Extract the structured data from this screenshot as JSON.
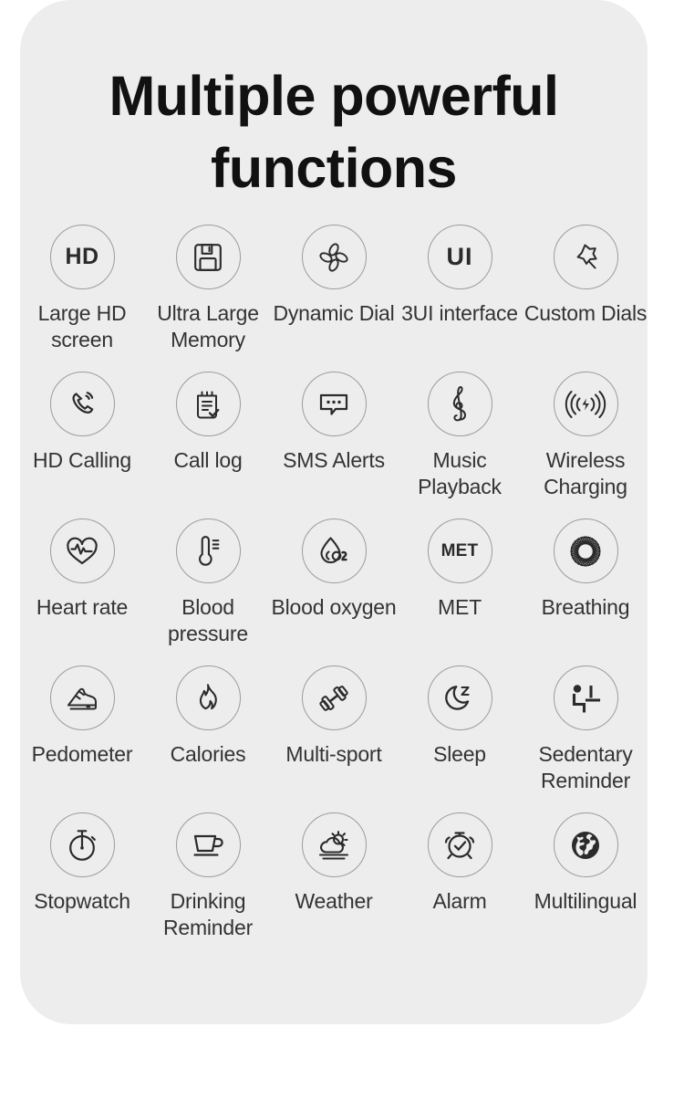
{
  "header": {
    "title_line1": "Multiple powerful",
    "title_line2": "functions",
    "title": "Multiple powerful functions"
  },
  "colors": {
    "card_background": "#ededed",
    "page_background": "#ffffff",
    "title_text": "#111111",
    "label_text": "#333333",
    "circle_stroke": "#9c9c9c",
    "icon_stroke": "#2b2b2b"
  },
  "features": [
    {
      "label": "Large HD screen",
      "icon": "hd-text-icon",
      "icon_text": "HD"
    },
    {
      "label": "Ultra Large Memory",
      "icon": "floppy-disk-icon",
      "icon_text": ""
    },
    {
      "label": "Dynamic Dial",
      "icon": "pinwheel-petals-icon",
      "icon_text": ""
    },
    {
      "label": "3UI interface",
      "icon": "ui-text-icon",
      "icon_text": "UI"
    },
    {
      "label": "Custom Dials",
      "icon": "magic-wand-star-icon",
      "icon_text": ""
    },
    {
      "label": "HD Calling",
      "icon": "phone-handset-waves-icon",
      "icon_text": ""
    },
    {
      "label": "Call log",
      "icon": "clipboard-check-icon",
      "icon_text": ""
    },
    {
      "label": "SMS Alerts",
      "icon": "chat-bubble-dots-icon",
      "icon_text": ""
    },
    {
      "label": "Music Playback",
      "icon": "treble-clef-icon",
      "icon_text": ""
    },
    {
      "label": "Wireless Charging",
      "icon": "wireless-bolt-icon",
      "icon_text": ""
    },
    {
      "label": "Heart rate",
      "icon": "heart-pulse-icon",
      "icon_text": ""
    },
    {
      "label": "Blood pressure",
      "icon": "thermometer-icon",
      "icon_text": ""
    },
    {
      "label": "Blood oxygen",
      "icon": "droplet-o2-icon",
      "icon_text": ""
    },
    {
      "label": "MET",
      "icon": "met-text-icon",
      "icon_text": "MET"
    },
    {
      "label": "Breathing",
      "icon": "spiral-rosette-icon",
      "icon_text": ""
    },
    {
      "label": "Pedometer",
      "icon": "sneaker-icon",
      "icon_text": ""
    },
    {
      "label": "Calories",
      "icon": "flame-icon",
      "icon_text": ""
    },
    {
      "label": "Multi-sport",
      "icon": "dumbbell-icon",
      "icon_text": ""
    },
    {
      "label": "Sleep",
      "icon": "moon-z-icon",
      "icon_text": ""
    },
    {
      "label": "Sedentary Reminder",
      "icon": "seated-person-icon",
      "icon_text": ""
    },
    {
      "label": "Stopwatch",
      "icon": "stopwatch-icon",
      "icon_text": ""
    },
    {
      "label": "Drinking Reminder",
      "icon": "coffee-cup-icon",
      "icon_text": ""
    },
    {
      "label": "Weather",
      "icon": "sun-cloud-icon",
      "icon_text": ""
    },
    {
      "label": "Alarm",
      "icon": "alarm-clock-icon",
      "icon_text": ""
    },
    {
      "label": "Multilingual",
      "icon": "globe-icon",
      "icon_text": ""
    }
  ],
  "layout": {
    "columns": 5,
    "rows": 5,
    "total_features": 25
  }
}
